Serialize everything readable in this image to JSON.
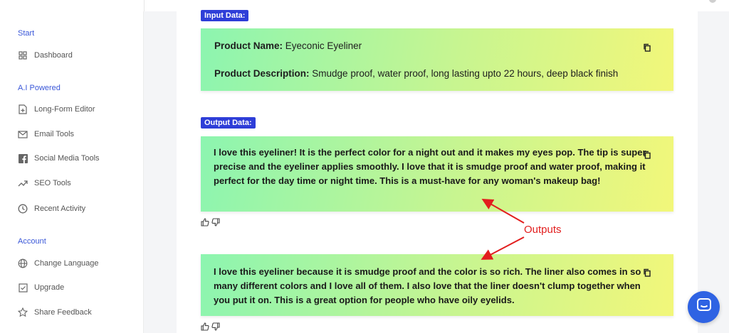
{
  "sidebar": {
    "sections": [
      {
        "title": "Start",
        "items": [
          {
            "label": "Dashboard",
            "icon": "dashboard-icon"
          }
        ]
      },
      {
        "title": "A.I Powered",
        "items": [
          {
            "label": "Long-Form Editor",
            "icon": "document-plus-icon"
          },
          {
            "label": "Email Tools",
            "icon": "envelope-icon"
          },
          {
            "label": "Social Media Tools",
            "icon": "facebook-icon"
          },
          {
            "label": "SEO Tools",
            "icon": "trending-up-icon"
          },
          {
            "label": "Recent Activity",
            "icon": "clock-icon"
          }
        ]
      },
      {
        "title": "Account",
        "items": [
          {
            "label": "Change Language",
            "icon": "globe-icon"
          },
          {
            "label": "Upgrade",
            "icon": "checkbox-icon"
          },
          {
            "label": "Share Feedback",
            "icon": "star-icon"
          }
        ]
      }
    ]
  },
  "input": {
    "badge": "Input Data:",
    "name_label": "Product Name:",
    "name_value": "Eyeconic Eyeliner",
    "desc_label": "Product Description:",
    "desc_value": "Smudge proof, water proof, long lasting upto 22 hours, deep black finish"
  },
  "output": {
    "badge": "Output Data:",
    "results": [
      "I love this eyeliner! It is the perfect color for a night out and it makes my eyes pop. The tip is super precise and the eyeliner applies smoothly. I love that it is smudge proof and water proof, making it perfect for the day time or night time. This is a must-have for any woman's makeup bag!",
      "I love this eyeliner because it is smudge proof and the color is so rich. The liner also comes in so many different colors and I love all of them. I also love that the liner doesn't clump together when you put it on. This is a great option for people who have oily eyelids."
    ]
  },
  "annotation": {
    "text": "Outputs",
    "color": "#e21e1e"
  },
  "colors": {
    "accent": "#3a57d8",
    "badge": "#2e3ed8",
    "chat": "#2f63e3"
  }
}
